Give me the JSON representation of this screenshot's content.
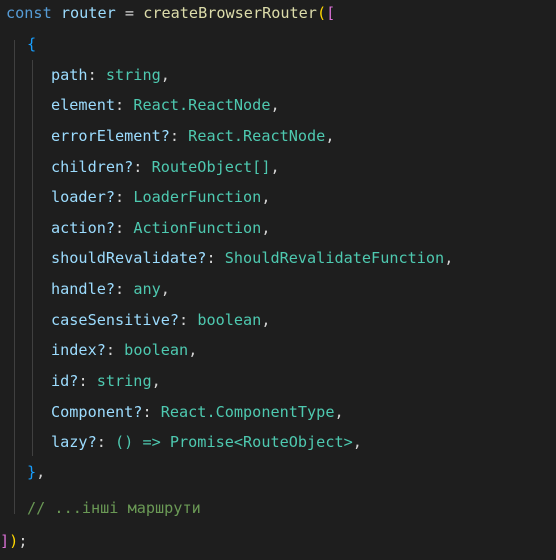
{
  "code": {
    "l1": {
      "kw": "const",
      "name": "router",
      "eq": "=",
      "fn": "createBrowserRouter",
      "open_paren": "(",
      "open_bracket": "["
    },
    "l2": {
      "brace": "{"
    },
    "props": [
      {
        "key": "path",
        "sep": ": ",
        "value": "string",
        "end": ","
      },
      {
        "key": "element",
        "sep": ": ",
        "value": "React.ReactNode",
        "end": ","
      },
      {
        "key": "errorElement?",
        "sep": ": ",
        "value": "React.ReactNode",
        "end": ","
      },
      {
        "key": "children?",
        "sep": ": ",
        "value": "RouteObject[]",
        "end": ","
      },
      {
        "key": "loader?",
        "sep": ": ",
        "value": "LoaderFunction",
        "end": ","
      },
      {
        "key": "action?",
        "sep": ": ",
        "value": "ActionFunction",
        "end": ","
      },
      {
        "key": "shouldRevalidate?",
        "sep": ": ",
        "value": "ShouldRevalidateFunction",
        "end": ","
      },
      {
        "key": "handle?",
        "sep": ": ",
        "value": "any",
        "end": ","
      },
      {
        "key": "caseSensitive?",
        "sep": ": ",
        "value": "boolean",
        "end": ","
      },
      {
        "key": "index?",
        "sep": ": ",
        "value": "boolean",
        "end": ","
      },
      {
        "key": "id?",
        "sep": ": ",
        "value": "string",
        "end": ","
      },
      {
        "key": "Component?",
        "sep": ": ",
        "value": "React.ComponentType",
        "end": ","
      },
      {
        "key": "lazy?",
        "sep": ": ",
        "value": "() => Promise<RouteObject>",
        "end": ","
      }
    ],
    "l16": {
      "brace_close": "}",
      "end": ","
    },
    "l17": {
      "comment": "// ...інші маршрути"
    },
    "l18": {
      "close_bracket": "]",
      "close_paren": ")",
      "semi": ";"
    }
  }
}
